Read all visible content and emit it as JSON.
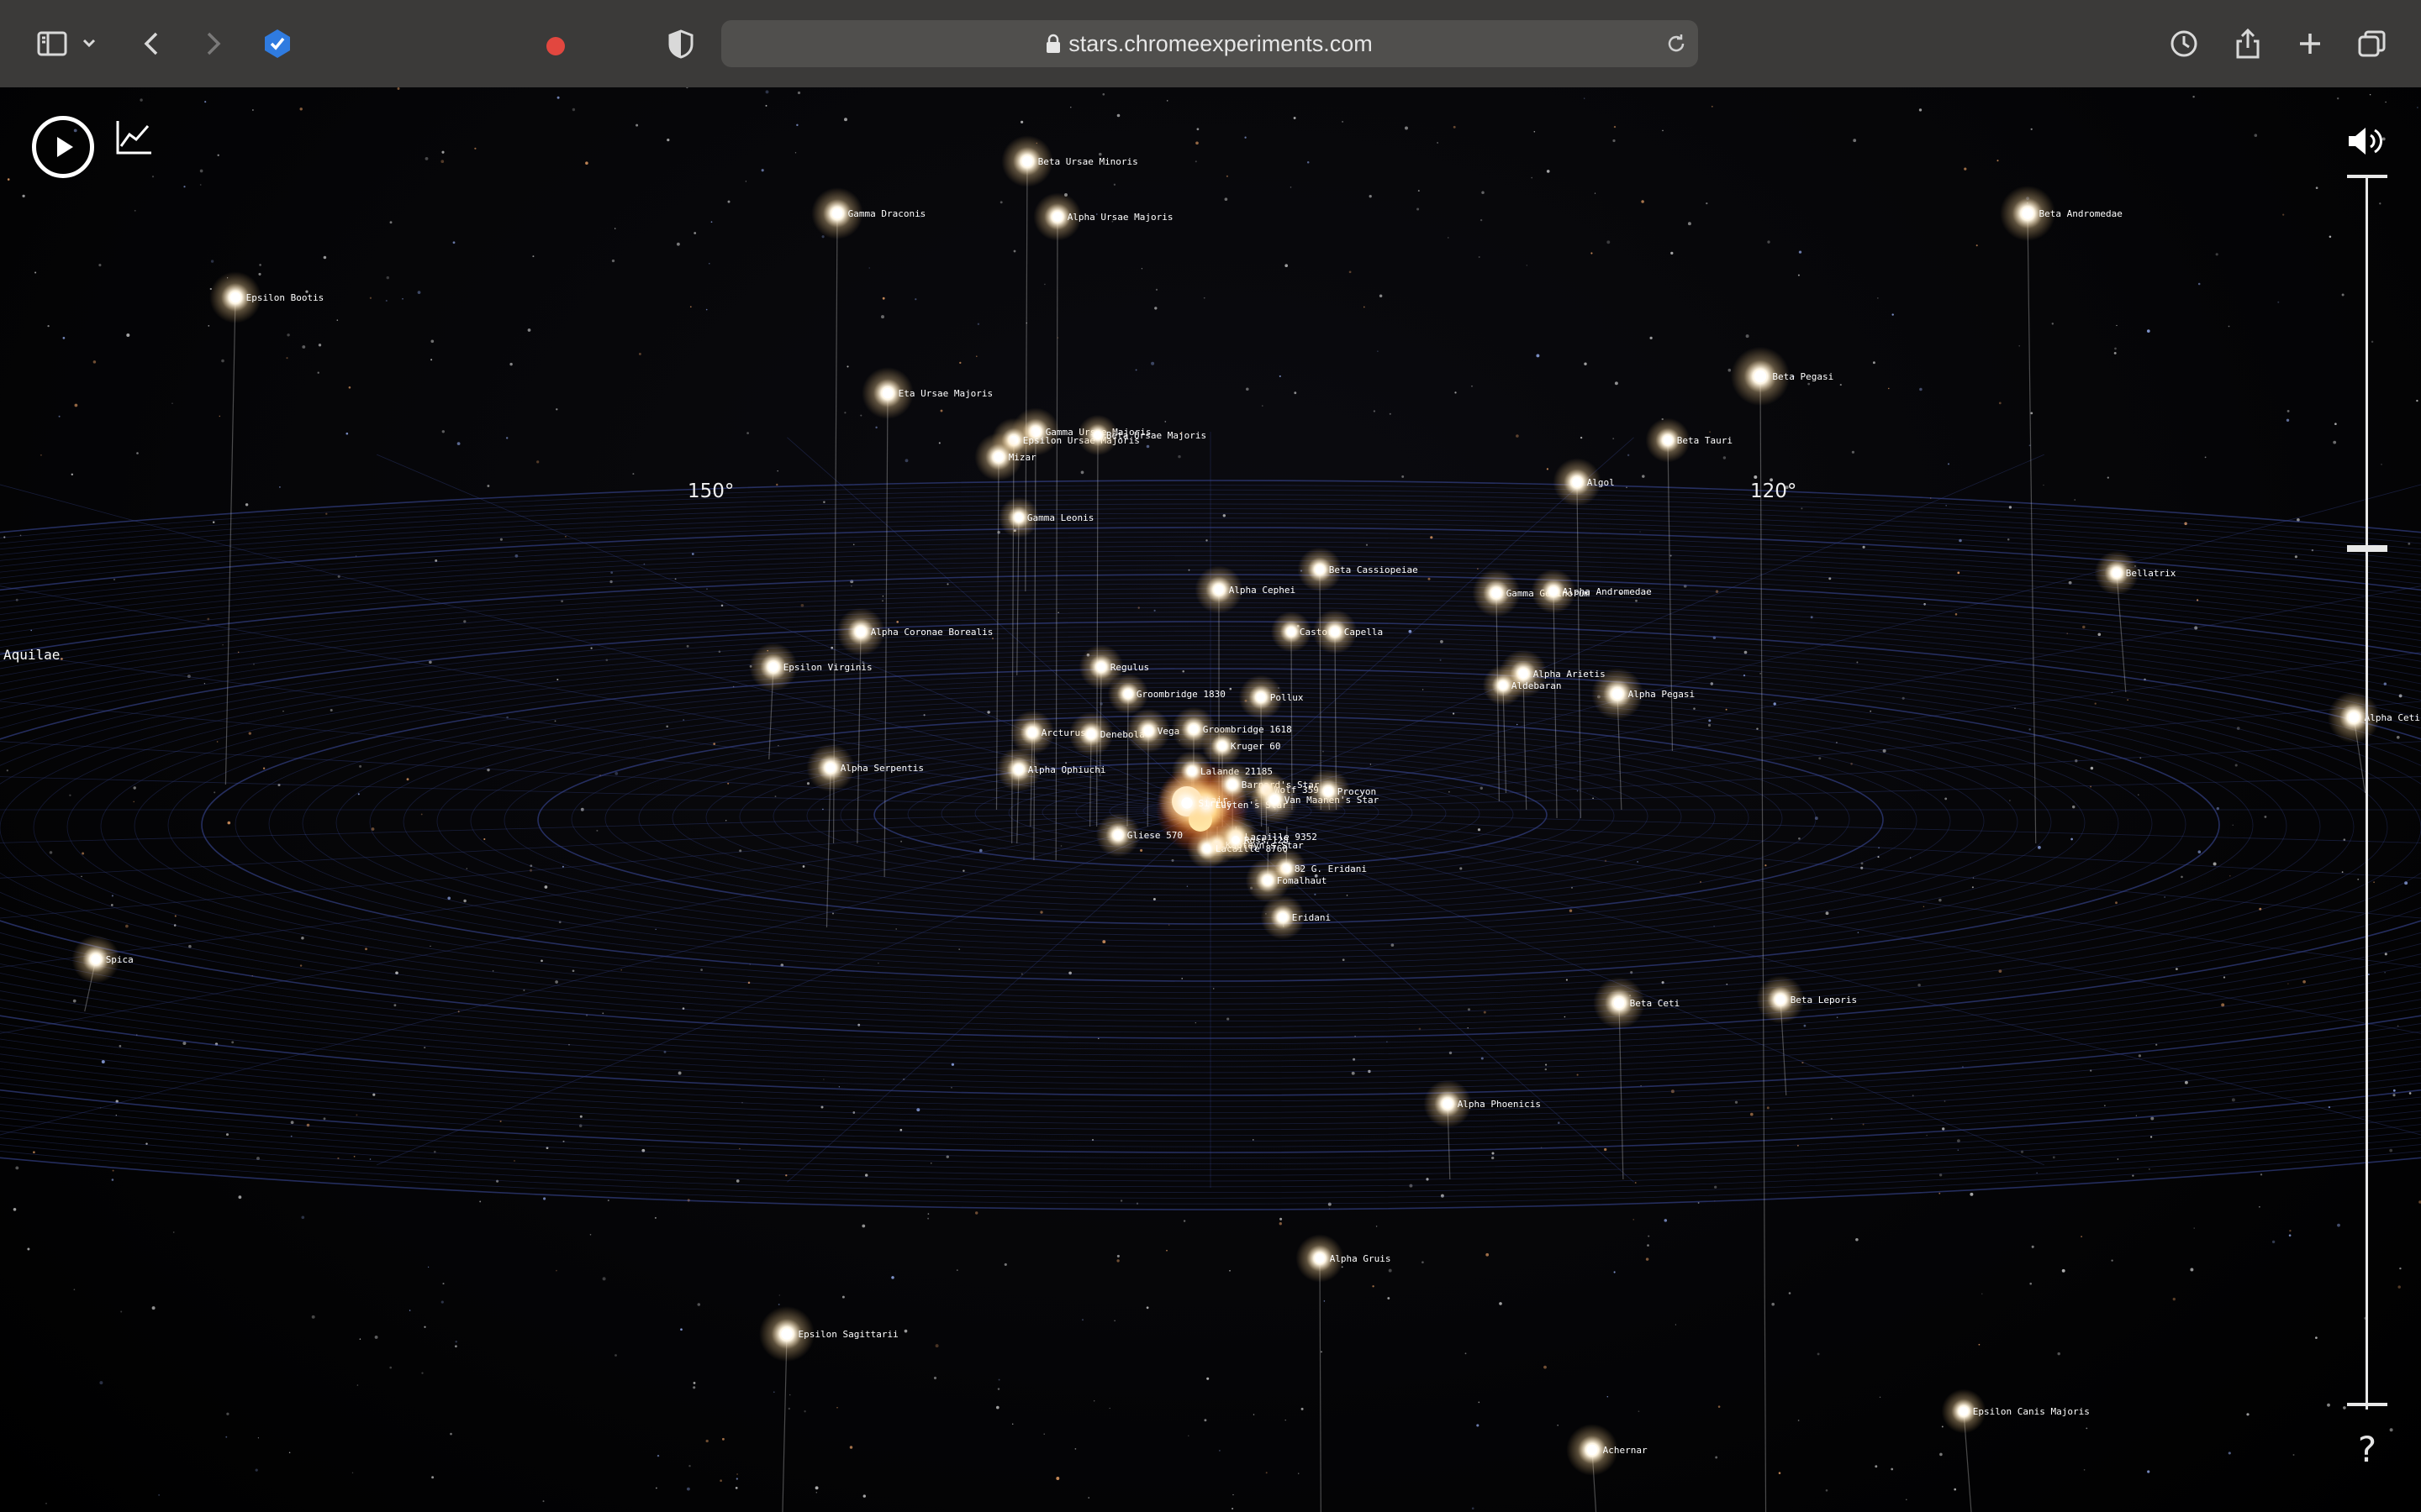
{
  "browser": {
    "url": "stars.chromeexperiments.com"
  },
  "scene": {
    "degree_labels": [
      "150°",
      "120°"
    ],
    "constellation_label": "Aquilae",
    "stars": [
      {
        "name": "Beta Ursae Minoris"
      },
      {
        "name": "Gamma Draconis"
      },
      {
        "name": "Alpha Ursae Majoris"
      },
      {
        "name": "Epsilon Bootis"
      },
      {
        "name": "Beta Andromedae"
      },
      {
        "name": "Eta Ursae Majoris"
      },
      {
        "name": "Beta Pegasi"
      },
      {
        "name": "Gamma Ursae Majoris"
      },
      {
        "name": "Epsilon Ursae Majoris"
      },
      {
        "name": "Beta Ursae Majoris"
      },
      {
        "name": "Mizar"
      },
      {
        "name": "Beta Tauri"
      },
      {
        "name": "Algol"
      },
      {
        "name": "Gamma Leonis"
      },
      {
        "name": "Alpha Cephei"
      },
      {
        "name": "Beta Cassiopeiae"
      },
      {
        "name": "Gamma Geminorum"
      },
      {
        "name": "Alpha Andromedae"
      },
      {
        "name": "Bellatrix"
      },
      {
        "name": "Alpha Coronae Borealis"
      },
      {
        "name": "Castor"
      },
      {
        "name": "Capella"
      },
      {
        "name": "Epsilon Virginis"
      },
      {
        "name": "Regulus"
      },
      {
        "name": "Alpha Arietis"
      },
      {
        "name": "Aldebaran"
      },
      {
        "name": "Alpha Pegasi"
      },
      {
        "name": "Groombridge 1830"
      },
      {
        "name": "Pollux"
      },
      {
        "name": "Alpha Ceti"
      },
      {
        "name": "Arcturus"
      },
      {
        "name": "Denebola"
      },
      {
        "name": "Vega"
      },
      {
        "name": "Groombridge 1618"
      },
      {
        "name": "Kruger 60"
      },
      {
        "name": "Alpha Serpentis"
      },
      {
        "name": "Alpha Ophiuchi"
      },
      {
        "name": "Lalande 21185"
      },
      {
        "name": "Barnard's Star"
      },
      {
        "name": "Wolf 359"
      },
      {
        "name": "Altair"
      },
      {
        "name": "Luyten's Star"
      },
      {
        "name": "Van Maanen's Star"
      },
      {
        "name": "Gliese 570"
      },
      {
        "name": "Procyon"
      },
      {
        "name": "Sirius"
      },
      {
        "name": "Lacaille 9352"
      },
      {
        "name": "Kapteyn's Star"
      },
      {
        "name": "Lacaille 8760"
      },
      {
        "name": "Ross 128"
      },
      {
        "name": "82 G. Eridani"
      },
      {
        "name": "Fomalhaut"
      },
      {
        "name": "Eridani"
      },
      {
        "name": "Spica"
      },
      {
        "name": "Beta Ceti"
      },
      {
        "name": "Beta Leporis"
      },
      {
        "name": "Alpha Phoenicis"
      },
      {
        "name": "Alpha Gruis"
      },
      {
        "name": "Epsilon Sagittarii"
      },
      {
        "name": "Epsilon Canis Majoris"
      },
      {
        "name": "Achernar"
      }
    ]
  },
  "controls": {
    "help_label": "?"
  },
  "colors": {
    "toolbar": "#3b3a39",
    "addressbar": "#504f4d",
    "grid": "#3a4a9a",
    "star_glow": "#fff3d6",
    "sun_cluster": "#ff9a3c"
  }
}
